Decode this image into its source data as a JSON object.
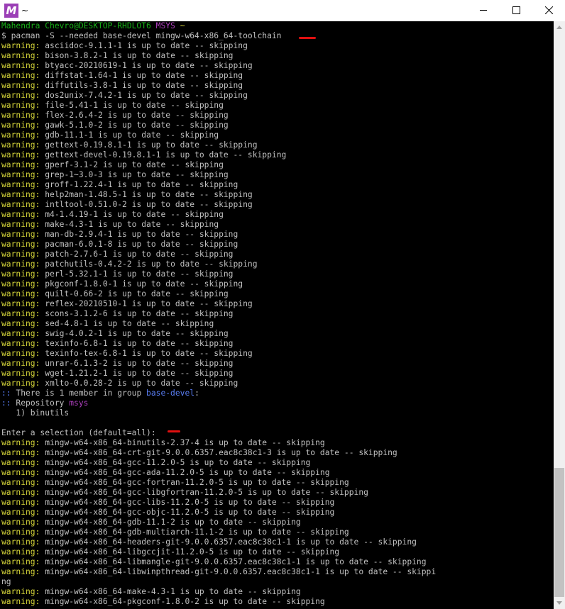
{
  "window": {
    "title": "~",
    "app_icon_letter": "M",
    "app_icon_color": "#9b3fb6",
    "buttons": [
      "minimize",
      "maximize",
      "close"
    ]
  },
  "colors": {
    "background": "#000000",
    "warning": "#d6d63a",
    "user_host": "#18b218",
    "msys": "#b040c0",
    "group_link": "#5a7ef5",
    "text": "#c0c0c0",
    "annotation_mark": "#e01010"
  },
  "terminal": {
    "prompt": {
      "user_host": "Mahendra Chevro@DESKTOP-RHDLOT6",
      "env": "MSYS",
      "path": "~"
    },
    "command": "$ pacman -S --needed base-devel mingw-w64-x86_64-toolchain",
    "warning_label": "warning:",
    "warnings_a": [
      "asciidoc-9.1.1-1 is up to date -- skipping",
      "bison-3.8.2-1 is up to date -- skipping",
      "btyacc-20210619-1 is up to date -- skipping",
      "diffstat-1.64-1 is up to date -- skipping",
      "diffutils-3.8-1 is up to date -- skipping",
      "dos2unix-7.4.2-1 is up to date -- skipping",
      "file-5.41-1 is up to date -- skipping",
      "flex-2.6.4-2 is up to date -- skipping",
      "gawk-5.1.0-2 is up to date -- skipping",
      "gdb-11.1-1 is up to date -- skipping",
      "gettext-0.19.8.1-1 is up to date -- skipping",
      "gettext-devel-0.19.8.1-1 is up to date -- skipping",
      "gperf-3.1-2 is up to date -- skipping",
      "grep-1~3.0-3 is up to date -- skipping",
      "groff-1.22.4-1 is up to date -- skipping",
      "help2man-1.48.5-1 is up to date -- skipping",
      "intltool-0.51.0-2 is up to date -- skipping",
      "m4-1.4.19-1 is up to date -- skipping",
      "make-4.3-1 is up to date -- skipping",
      "man-db-2.9.4-1 is up to date -- skipping",
      "pacman-6.0.1-8 is up to date -- skipping",
      "patch-2.7.6-1 is up to date -- skipping",
      "patchutils-0.4.2-2 is up to date -- skipping",
      "perl-5.32.1-1 is up to date -- skipping",
      "pkgconf-1.8.0-1 is up to date -- skipping",
      "quilt-0.66-2 is up to date -- skipping",
      "reflex-20210510-1 is up to date -- skipping",
      "scons-3.1.2-6 is up to date -- skipping",
      "sed-4.8-1 is up to date -- skipping",
      "swig-4.0.2-1 is up to date -- skipping",
      "texinfo-6.8-1 is up to date -- skipping",
      "texinfo-tex-6.8-1 is up to date -- skipping",
      "unrar-6.1.3-2 is up to date -- skipping",
      "wget-1.21.2-1 is up to date -- skipping",
      "xmlto-0.0.28-2 is up to date -- skipping"
    ],
    "group_line": {
      "prefix": "::",
      "text": " There is 1 member in group ",
      "group": "base-devel",
      "suffix": ":"
    },
    "repo_line": {
      "prefix": "::",
      "text": " Repository ",
      "repo": "msys"
    },
    "member_item": "   1) binutils",
    "selection_prompt": "Enter a selection (default=all):",
    "warnings_b": [
      "mingw-w64-x86_64-binutils-2.37-4 is up to date -- skipping",
      "mingw-w64-x86_64-crt-git-9.0.0.6357.eac8c38c1-3 is up to date -- skipping",
      "mingw-w64-x86_64-gcc-11.2.0-5 is up to date -- skipping",
      "mingw-w64-x86_64-gcc-ada-11.2.0-5 is up to date -- skipping",
      "mingw-w64-x86_64-gcc-fortran-11.2.0-5 is up to date -- skipping",
      "mingw-w64-x86_64-gcc-libgfortran-11.2.0-5 is up to date -- skipping",
      "mingw-w64-x86_64-gcc-libs-11.2.0-5 is up to date -- skipping",
      "mingw-w64-x86_64-gcc-objc-11.2.0-5 is up to date -- skipping",
      "mingw-w64-x86_64-gdb-11.1-2 is up to date -- skipping",
      "mingw-w64-x86_64-gdb-multiarch-11.1-2 is up to date -- skipping",
      "mingw-w64-x86_64-headers-git-9.0.0.6357.eac8c38c1-1 is up to date -- skipping",
      "mingw-w64-x86_64-libgccjit-11.2.0-5 is up to date -- skipping",
      "mingw-w64-x86_64-libmangle-git-9.0.0.6357.eac8c38c1-1 is up to date -- skipping",
      "mingw-w64-x86_64-libwinpthread-git-9.0.0.6357.eac8c38c1-1 is up to date -- skippi"
    ],
    "wrap_tail": "ng",
    "warnings_c": [
      "mingw-w64-x86_64-make-4.3-1 is up to date -- skipping",
      "mingw-w64-x86_64-pkgconf-1.8.0-2 is up to date -- skipping"
    ]
  }
}
